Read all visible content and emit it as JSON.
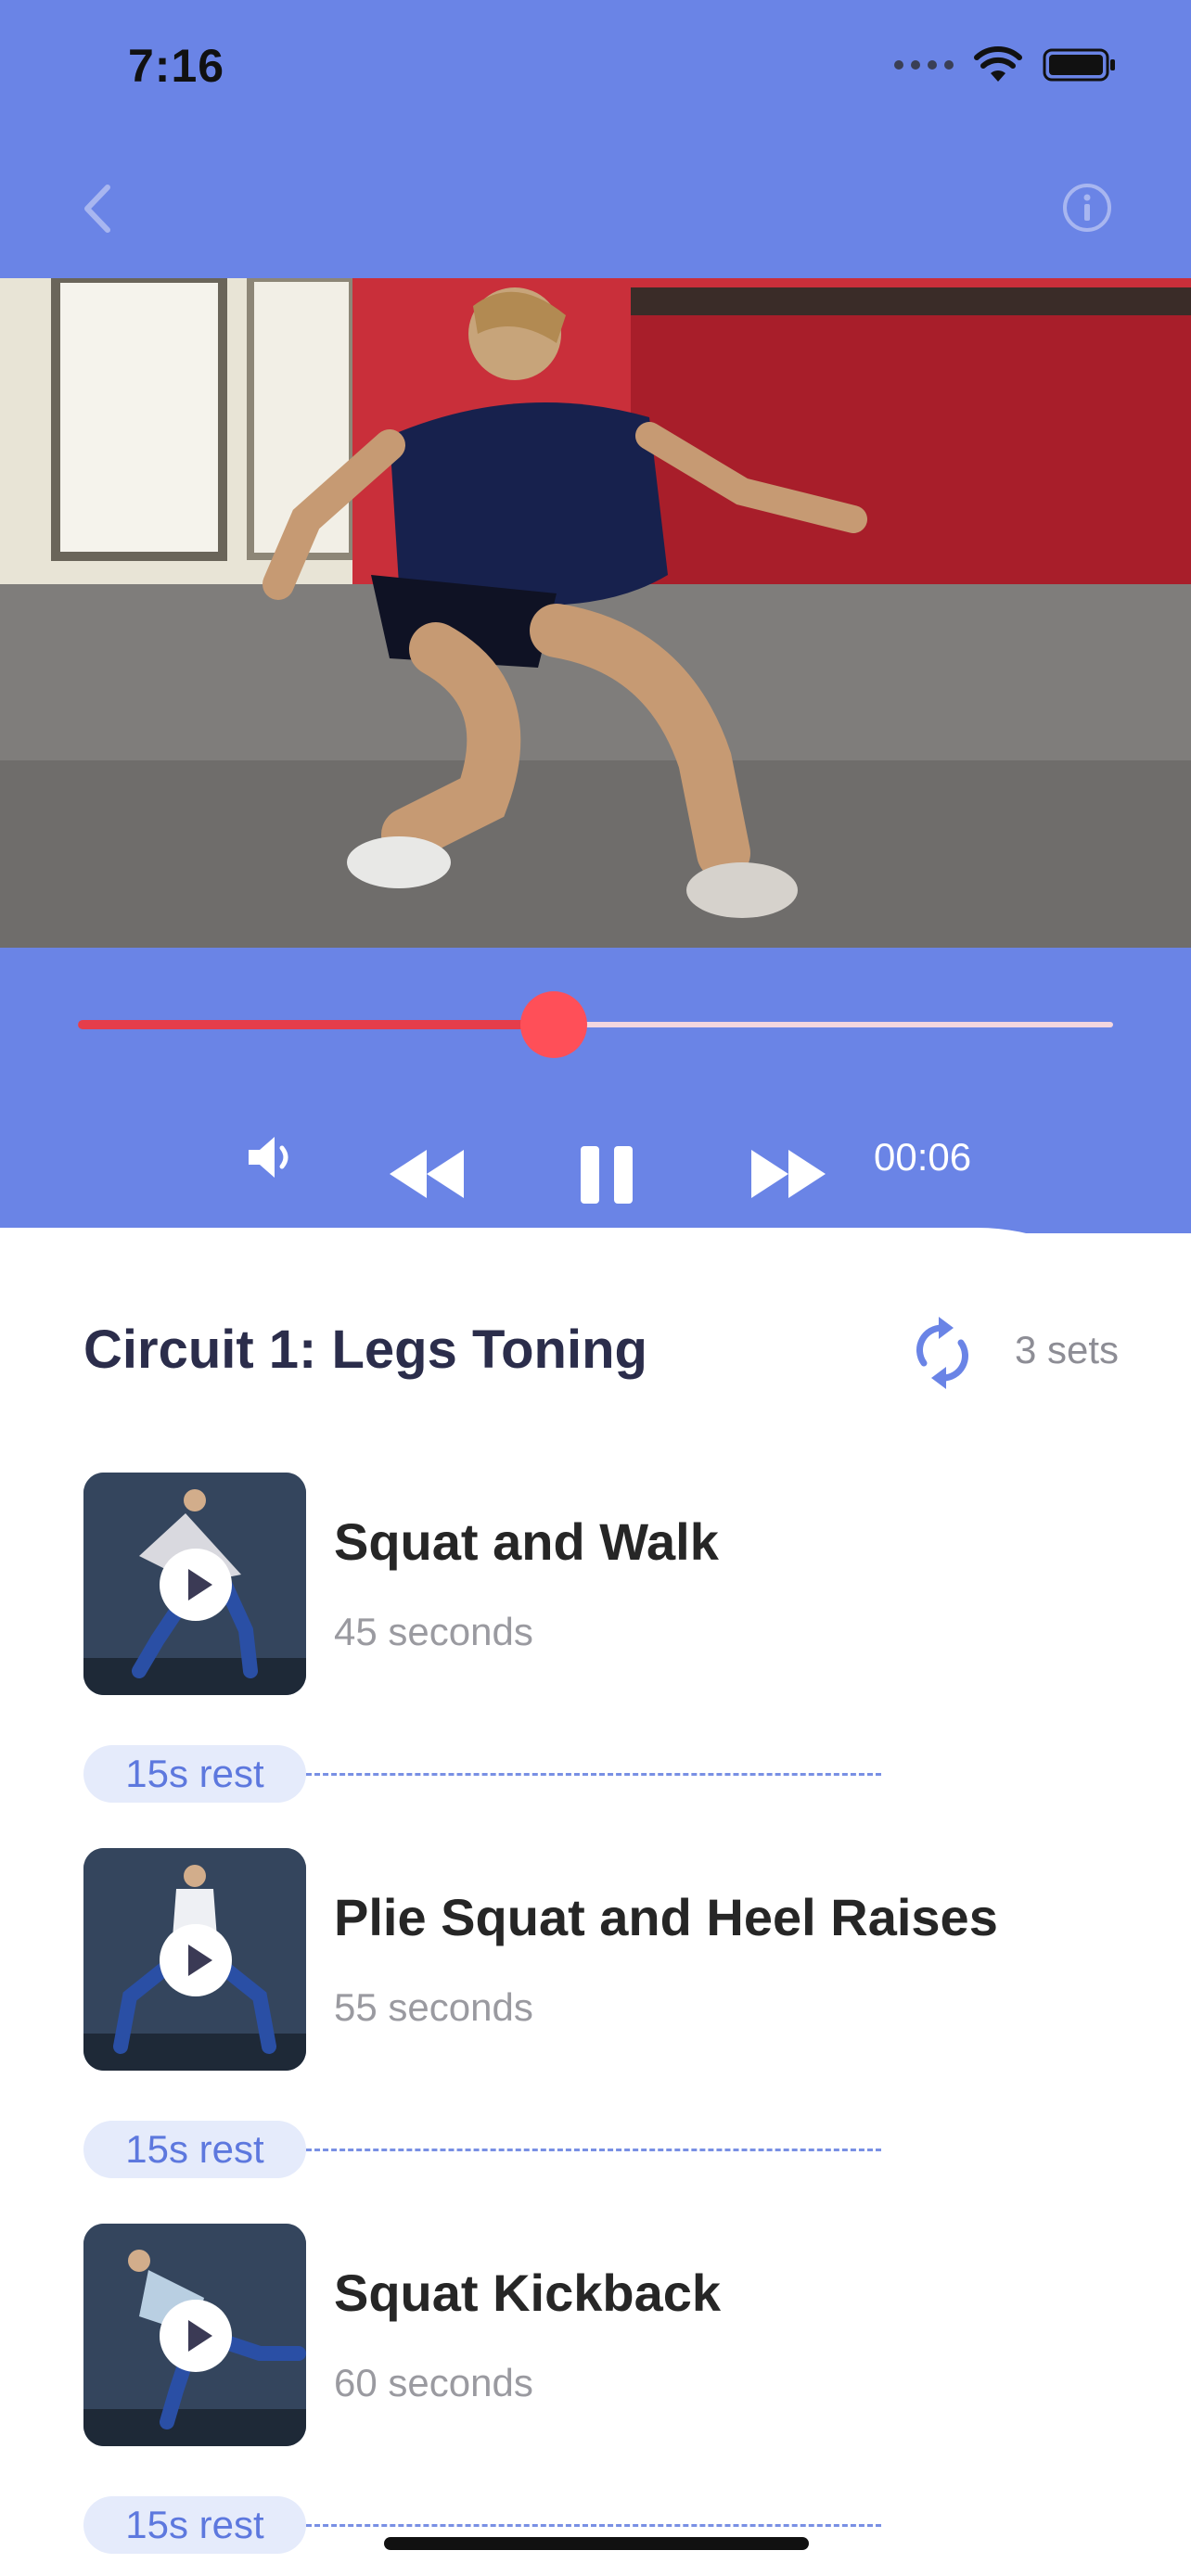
{
  "status_bar": {
    "time": "7:16"
  },
  "colors": {
    "header_bg": "#6a84e6",
    "accent_red": "#ff4f58",
    "rest_pill_bg": "#e5ebfb",
    "rest_text": "#5d78de"
  },
  "player": {
    "progress": 0.46,
    "elapsed": "00:06",
    "icons": [
      "speaker-icon",
      "rewind-icon",
      "pause-icon",
      "fast-forward-icon"
    ]
  },
  "circuit": {
    "title": "Circuit 1: Legs Toning",
    "sets": "3 sets"
  },
  "exercises": [
    {
      "name": "Squat and Walk",
      "duration": "45 seconds",
      "rest": "15s rest"
    },
    {
      "name": "Plie Squat and Heel Raises",
      "duration": "55 seconds",
      "rest": "15s rest"
    },
    {
      "name": "Squat Kickback",
      "duration": "60 seconds",
      "rest": "15s rest"
    }
  ]
}
